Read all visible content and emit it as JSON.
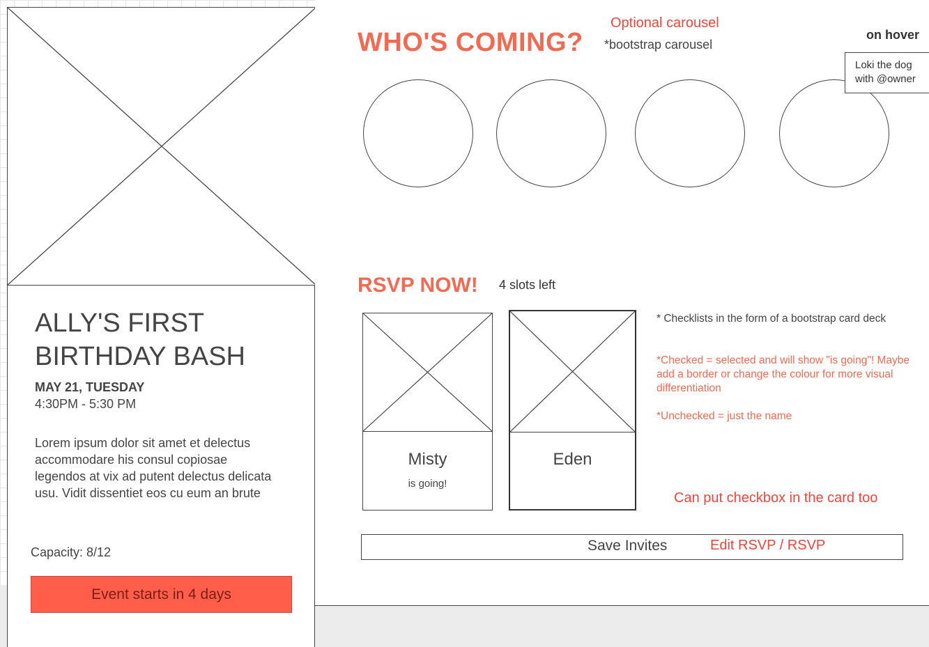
{
  "event": {
    "title": "ALLY'S FIRST BIRTHDAY BASH",
    "date": "MAY 21, TUESDAY",
    "time": "4:30PM - 5:30 PM",
    "description": "Lorem ipsum dolor sit amet et delectus accommodare his consul copiosae legendos at vix ad putent delectus delicata usu. Vidit dissentiet eos cu eum an brute",
    "capacity": "Capacity: 8/12",
    "countdown": "Event starts in 4 days"
  },
  "coming": {
    "heading": "WHO'S COMING?",
    "carousel_note": "Optional carousel",
    "carousel_sub": "*bootstrap carousel",
    "hover_label": "on hover",
    "tooltip_line1": "Loki the dog",
    "tooltip_line2": "with @owner"
  },
  "rsvp": {
    "heading": "RSVP NOW!",
    "slots": "4 slots left",
    "cards": [
      {
        "name": "Misty",
        "status": "is going!"
      },
      {
        "name": "Eden",
        "status": ""
      }
    ],
    "checklist_note": "* Checklists in the form of a bootstrap card deck",
    "checked_note": "*Checked = selected and will show \"is going\"! Maybe add a border or change the colour for more visual differentiation",
    "unchecked_note": "*Unchecked = just the name",
    "checkbox_note": "Can put checkbox in the card too",
    "save_label": "Save Invites",
    "edit_note": "Edit RSVP / RSVP"
  },
  "colors": {
    "accent": "#f26a51",
    "countdown_bg": "#ff5f4a",
    "annotation": "#f0453a"
  }
}
